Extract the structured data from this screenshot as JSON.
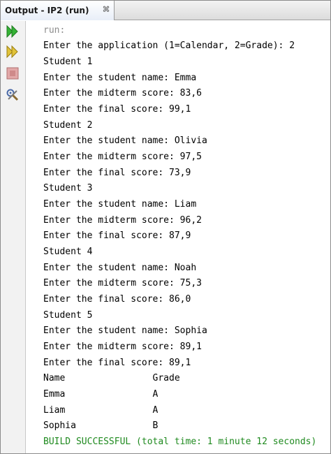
{
  "tab": {
    "title": "Output - IP2 (run)",
    "close_glyph": "⌘"
  },
  "toolbar": {
    "icons": [
      "rerun-icon",
      "rerun-with-options-icon",
      "stop-icon",
      "settings-icon"
    ]
  },
  "colors": {
    "prompt_text": "#000000",
    "run_text": "#8c8c8c",
    "success_text": "#1f8a1f",
    "play_icon": "#2ba52b",
    "stop_icon": "#d28b8b"
  },
  "console": {
    "run_label": "run:",
    "lines": [
      "Enter the application (1=Calendar, 2=Grade): 2",
      "Student 1",
      "Enter the student name: Emma",
      "Enter the midterm score: 83,6",
      "Enter the final score: 99,1",
      "Student 2",
      "Enter the student name: Olivia",
      "Enter the midterm score: 97,5",
      "Enter the final score: 73,9",
      "Student 3",
      "Enter the student name: Liam",
      "Enter the midterm score: 96,2",
      "Enter the final score: 87,9",
      "Student 4",
      "Enter the student name: Noah",
      "Enter the midterm score: 75,3",
      "Enter the final score: 86,0",
      "Student 5",
      "Enter the student name: Sophia",
      "Enter the midterm score: 89,1",
      "Enter the final score: 89,1",
      "Name                Grade",
      "Emma                A",
      "Liam                A",
      "Sophia              B"
    ],
    "build_status": "BUILD SUCCESSFUL (total time: 1 minute 12 seconds)"
  }
}
